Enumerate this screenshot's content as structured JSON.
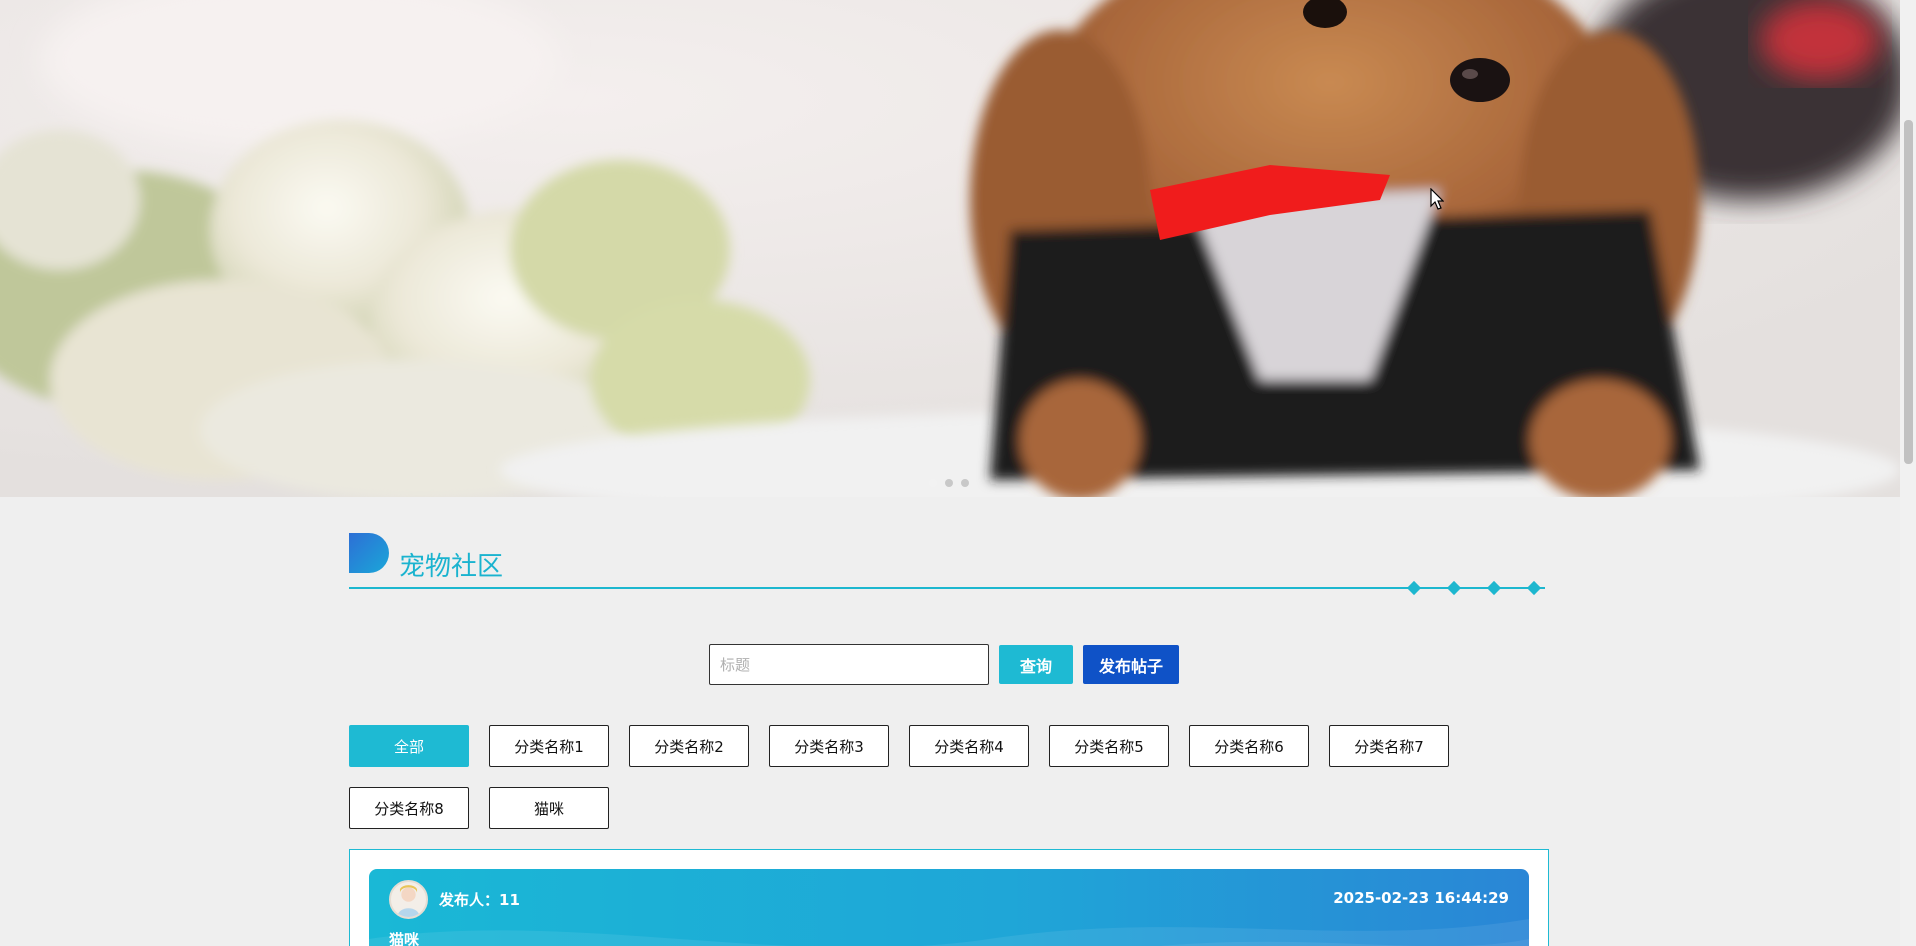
{
  "banner": {
    "slides": [
      {
        "label": ""
      },
      {
        "label": ""
      },
      {
        "label": ""
      }
    ],
    "active_index": 0
  },
  "section": {
    "title": "宠物社区"
  },
  "search": {
    "placeholder": "标题",
    "value": "",
    "query_label": "查询",
    "publish_label": "发布帖子"
  },
  "categories": {
    "items": [
      {
        "label": "全部"
      },
      {
        "label": "分类名称1"
      },
      {
        "label": "分类名称2"
      },
      {
        "label": "分类名称3"
      },
      {
        "label": "分类名称4"
      },
      {
        "label": "分类名称5"
      },
      {
        "label": "分类名称6"
      },
      {
        "label": "分类名称7"
      },
      {
        "label": "分类名称8"
      },
      {
        "label": "猫咪"
      }
    ],
    "active_index": 0
  },
  "posts": [
    {
      "author_label": "发布人：",
      "author": "11",
      "time": "2025-02-23 16:44:29",
      "title": "猫咪"
    }
  ],
  "colors": {
    "accent": "#1ebad3",
    "publish": "#0f52c7",
    "page_bg": "#efefef"
  }
}
